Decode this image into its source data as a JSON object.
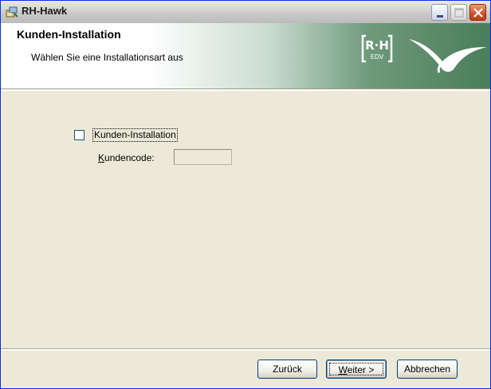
{
  "window": {
    "title": "RH-Hawk",
    "app_icon": "installer-icon",
    "controls": [
      "minimize-icon",
      "maximize-icon",
      "close-icon"
    ]
  },
  "header": {
    "title": "Kunden-Installation",
    "subtitle": "Wählen Sie eine Installationsart aus",
    "logo": {
      "line1": "R·H",
      "line2": "EDV"
    }
  },
  "options": {
    "customer_install": {
      "label": "Kunden-Installation",
      "checked": false
    },
    "customer_code": {
      "label_first": "K",
      "label_rest": "undencode:",
      "value": ""
    }
  },
  "footer": {
    "back_label": "Zurück",
    "next_label_first": "W",
    "next_label_rest": "eiter >",
    "cancel_label": "Abbrechen"
  },
  "colors": {
    "header_gradient_end": "#4a7d5b",
    "close_button": "#d64b25",
    "button_border": "#003c74"
  }
}
